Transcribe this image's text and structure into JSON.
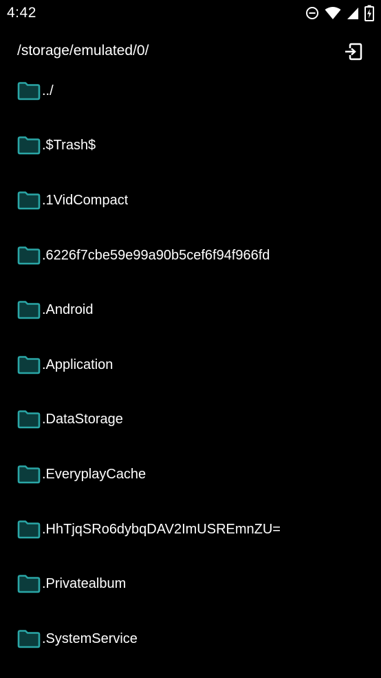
{
  "status_bar": {
    "time": "4:42",
    "icons": [
      "do-not-disturb-icon",
      "wifi-icon",
      "cellular-signal-icon",
      "battery-charging-icon"
    ]
  },
  "header": {
    "path": "/storage/emulated/0/",
    "exit_icon": "exit-to-app-icon"
  },
  "colors": {
    "background": "#000000",
    "text": "#ffffff",
    "folder_fill": "#0b3c3c",
    "folder_stroke": "#2aa6a6"
  },
  "files": [
    {
      "name": "../",
      "icon": "folder-icon"
    },
    {
      "name": ".$Trash$",
      "icon": "folder-icon"
    },
    {
      "name": ".1VidCompact",
      "icon": "folder-icon"
    },
    {
      "name": ".6226f7cbe59e99a90b5cef6f94f966fd",
      "icon": "folder-icon"
    },
    {
      "name": ".Android",
      "icon": "folder-icon"
    },
    {
      "name": ".Application",
      "icon": "folder-icon"
    },
    {
      "name": ".DataStorage",
      "icon": "folder-icon"
    },
    {
      "name": ".EveryplayCache",
      "icon": "folder-icon"
    },
    {
      "name": ".HhTjqSRo6dybqDAV2ImUSREmnZU=",
      "icon": "folder-icon"
    },
    {
      "name": ".Privatealbum",
      "icon": "folder-icon"
    },
    {
      "name": ".SystemService",
      "icon": "folder-icon"
    }
  ]
}
